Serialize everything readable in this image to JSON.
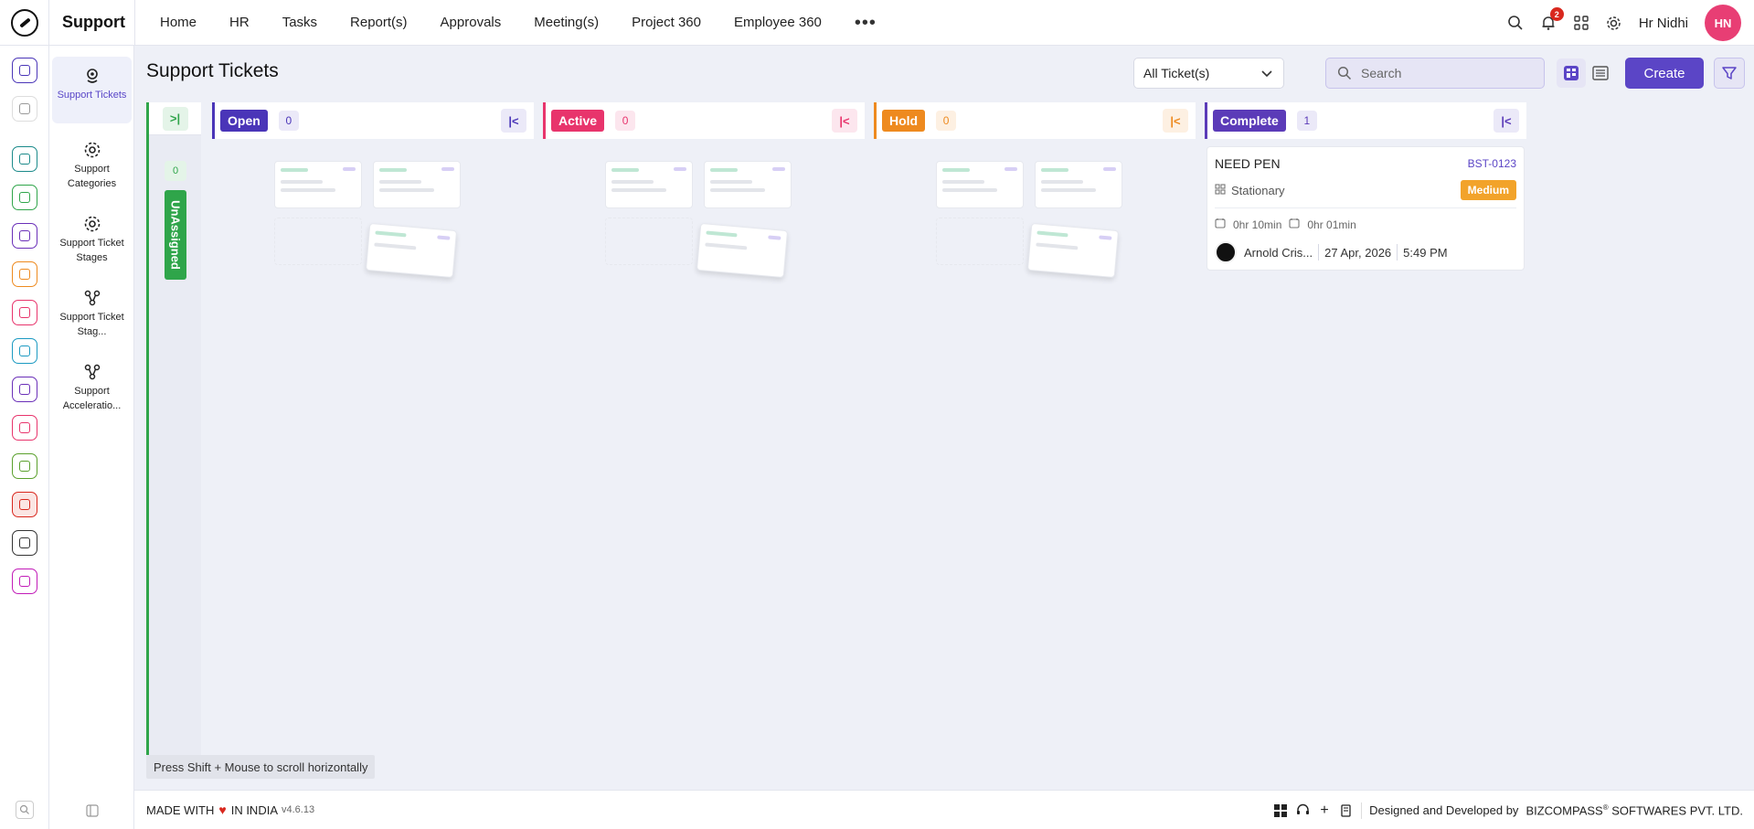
{
  "app": {
    "name": "Support"
  },
  "nav": {
    "items": [
      "Home",
      "HR",
      "Tasks",
      "Report(s)",
      "Approvals",
      "Meeting(s)",
      "Project 360",
      "Employee 360"
    ],
    "more": "•••"
  },
  "topbar": {
    "notification_count": "2",
    "user_name": "Hr Nidhi",
    "user_initials": "HN"
  },
  "rail": {
    "icons": [
      "home-icon",
      "pin-icon",
      "org-icon",
      "target-icon",
      "briefcase-icon",
      "hand-icon",
      "goal-icon",
      "archive-icon",
      "plane-icon",
      "monitor-icon",
      "document-icon",
      "support-icon",
      "building-icon",
      "settings-icon"
    ]
  },
  "submenu": {
    "items": [
      {
        "label": "Support Tickets",
        "active": true
      },
      {
        "label": "Support Categories"
      },
      {
        "label": "Support Ticket Stages"
      },
      {
        "label": "Support Ticket Stag..."
      },
      {
        "label": "Support Acceleratio..."
      }
    ]
  },
  "page": {
    "title": "Support Tickets",
    "filter_value": "All Ticket(s)",
    "search_placeholder": "Search",
    "create_label": "Create"
  },
  "board": {
    "unassigned": {
      "label": "UnAssigned",
      "count": "0",
      "expand": ">|"
    },
    "columns": [
      {
        "label": "Open",
        "count": "0",
        "color": "#4a35b8"
      },
      {
        "label": "Active",
        "count": "0",
        "color": "#e8346c"
      },
      {
        "label": "Hold",
        "count": "0",
        "color": "#ee8a1f"
      },
      {
        "label": "Complete",
        "count": "1",
        "color": "#5b3bb8"
      }
    ],
    "collapse": "|<"
  },
  "ticket": {
    "title": "NEED PEN",
    "id": "BST-0123",
    "category": "Stationary",
    "priority": "Medium",
    "time_spent": "0hr 10min",
    "time_estimate": "0hr 01min",
    "assignee": "Arnold Cris...",
    "date": "27 Apr, 2026",
    "time": "5:49 PM"
  },
  "hint": "Press Shift + Mouse to scroll horizontally",
  "footer": {
    "made_prefix": "MADE WITH",
    "made_suffix": "IN INDIA",
    "version": "v4.6.13",
    "designed_by": "Designed and Developed by",
    "company": "BIZCOMPASS",
    "company_rest": "SOFTWARES PVT. LTD."
  }
}
